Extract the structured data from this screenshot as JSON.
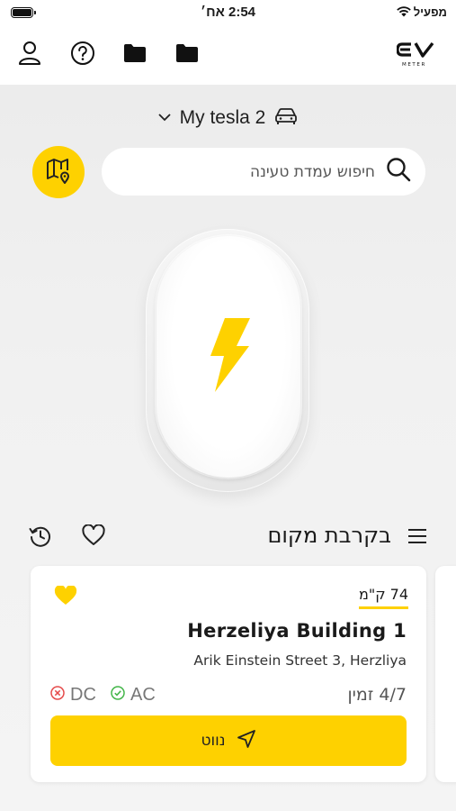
{
  "status_bar": {
    "time": "2:54 אח׳",
    "carrier": "מפעיל"
  },
  "app": {
    "logo_text": "EV",
    "logo_subtext": "METER"
  },
  "toolbar": {
    "icons": [
      "user-icon",
      "help-icon",
      "folder-icon",
      "folder-icon",
      "ev-meter-logo"
    ]
  },
  "vehicle": {
    "name": "My tesla 2"
  },
  "search": {
    "placeholder": "חיפוש עמדת טעינה"
  },
  "nearby": {
    "title": "בקרבת מקום"
  },
  "station": {
    "distance": "74 ק\"מ",
    "name": "Herzeliya Building 1",
    "address": "Arik Einstein Street 3, Herzliya",
    "availability": "4/7 זמין",
    "connectors": [
      {
        "type": "AC",
        "status": "available"
      },
      {
        "type": "DC",
        "status": "unavailable"
      }
    ],
    "favorite": true,
    "navigate_label": "נווט"
  },
  "colors": {
    "accent": "#fed100",
    "available": "#43b649",
    "unavailable": "#e54b4b"
  }
}
